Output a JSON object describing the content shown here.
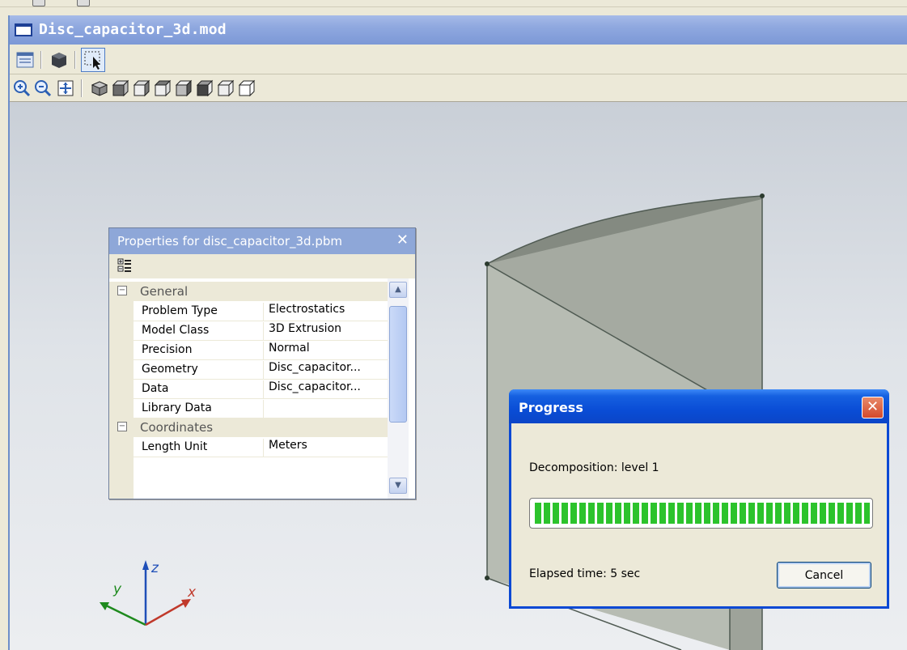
{
  "document": {
    "title": "Disc_capacitor_3d.mod"
  },
  "toolbars": {
    "row1": [
      "window-list-icon",
      "solid-view-icon",
      "select-icon"
    ],
    "row2": [
      "zoom-in-icon",
      "zoom-out-icon",
      "zoom-fit-icon",
      "view-iso-icon",
      "view-front-icon",
      "view-back-icon",
      "view-left-icon",
      "view-right-icon",
      "view-top-icon",
      "view-bottom-icon"
    ]
  },
  "properties": {
    "title": "Properties for disc_capacitor_3d.pbm",
    "close_glyph": "✕",
    "categories": {
      "general": "General",
      "coordinates": "Coordinates"
    },
    "rows": [
      {
        "name": "Problem Type",
        "value": "Electrostatics"
      },
      {
        "name": "Model Class",
        "value": "3D Extrusion"
      },
      {
        "name": "Precision",
        "value": "Normal"
      },
      {
        "name": "Geometry",
        "value": "Disc_capacitor..."
      },
      {
        "name": "Data",
        "value": "Disc_capacitor..."
      },
      {
        "name": "Library Data",
        "value": ""
      }
    ],
    "coord_rows": [
      {
        "name": "Length Unit",
        "value": "Meters"
      }
    ]
  },
  "axes": {
    "x": "x",
    "y": "y",
    "z": "z"
  },
  "progress": {
    "title": "Progress",
    "label": "Decomposition: level 1",
    "fraction": 1.0,
    "elapsed": "Elapsed time: 5 sec",
    "cancel_label": "Cancel",
    "close_glyph": "✕"
  },
  "colors": {
    "title_blue": "#0b49d4",
    "progress_green": "#2cc32c",
    "axis_x": "#c0392b",
    "axis_y": "#1e8a1e",
    "axis_z": "#1f4fb8"
  }
}
